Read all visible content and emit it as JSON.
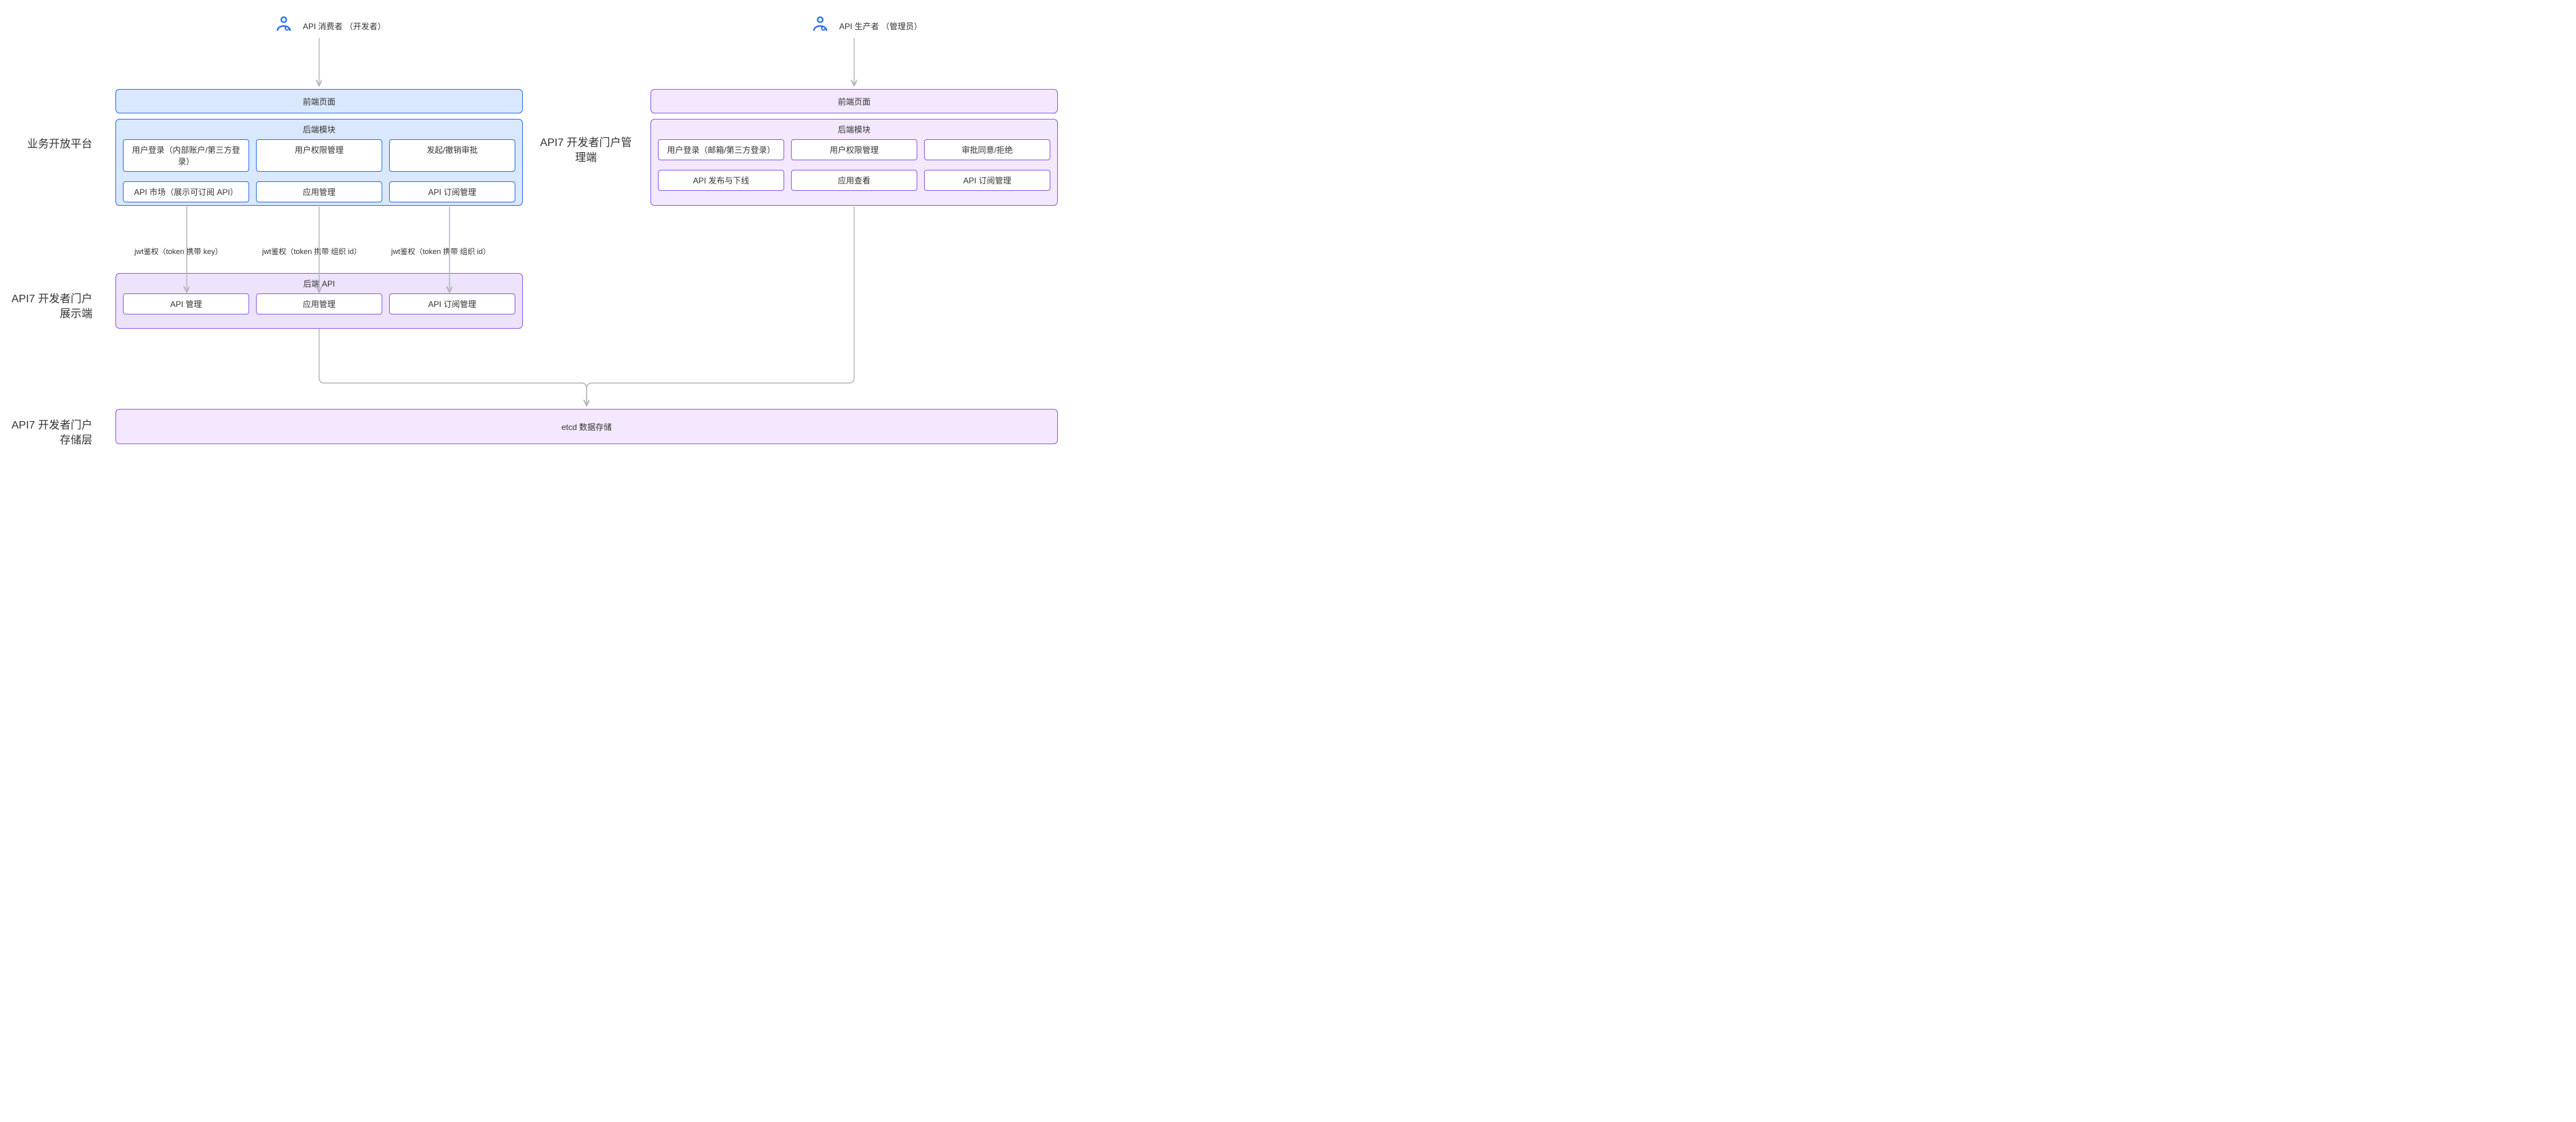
{
  "actors": {
    "consumer": "API 消费者 （开发者）",
    "producer": "API 生产者 （管理员）"
  },
  "sections": {
    "business_platform": "业务开放平台",
    "display_portal": "API7 开发者门户展示端",
    "admin_portal": "API7 开发者门户管理端",
    "storage": "API7 开发者门户存储层"
  },
  "left": {
    "frontend_title": "前端页面",
    "backend_title": "后端模块",
    "row1": {
      "c1": "用户登录（内部账户/第三方登录）",
      "c2": "用户权限管理",
      "c3": "发起/撤销审批"
    },
    "row2": {
      "c1": "API 市场（展示可订阅 API）",
      "c2": "应用管理",
      "c3": "API 订阅管理"
    },
    "api_title": "后端 API",
    "api_row": {
      "c1": "API 管理",
      "c2": "应用管理",
      "c3": "API 订阅管理"
    }
  },
  "right": {
    "frontend_title": "前端页面",
    "backend_title": "后端模块",
    "row1": {
      "c1": "用户登录（邮箱/第三方登录）",
      "c2": "用户权限管理",
      "c3": "审批同意/拒绝"
    },
    "row2": {
      "c1": "API 发布与下线",
      "c2": "应用查看",
      "c3": "API 订阅管理"
    }
  },
  "edges": {
    "jwt_key": "jwt鉴权（token 携带 key）",
    "jwt_org1": "jwt鉴权（token 携带 组织 id）",
    "jwt_org2": "jwt鉴权（token 携带 组织 id）"
  },
  "storage_box": "etcd 数据存储"
}
